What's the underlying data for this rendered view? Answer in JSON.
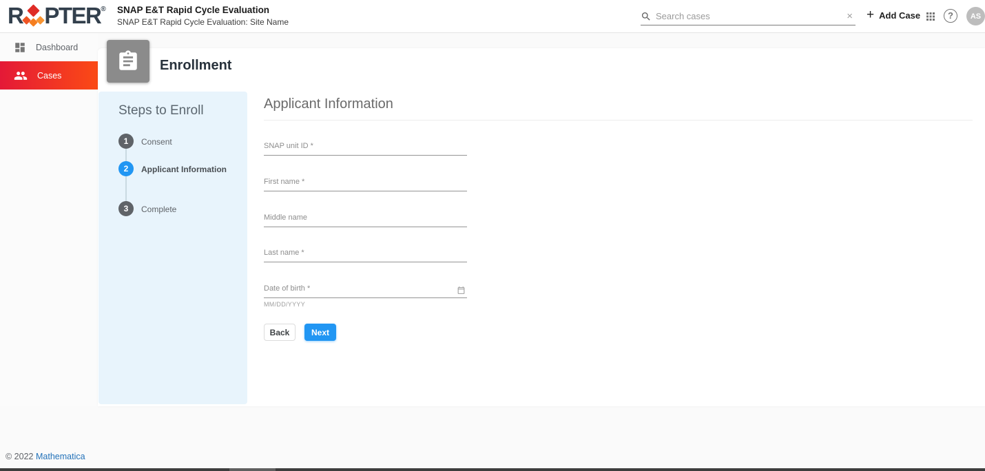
{
  "header": {
    "logo": {
      "text_prefix": "R",
      "text_suffix": "PTER",
      "registered": "®"
    },
    "title": "SNAP E&T Rapid Cycle Evaluation",
    "subtitle": "SNAP E&T Rapid Cycle Evaluation: Site Name",
    "search": {
      "placeholder": "Search cases",
      "clear_icon": "×"
    },
    "add_case": {
      "plus": "+",
      "label": "Add Case"
    },
    "help_glyph": "?",
    "avatar_initials": "AS"
  },
  "sidebar": {
    "items": [
      {
        "label": "Dashboard",
        "active": false
      },
      {
        "label": "Cases",
        "active": true
      }
    ]
  },
  "main": {
    "page_title": "Enrollment",
    "steps_panel": {
      "title": "Steps to Enroll",
      "steps": [
        {
          "number": "1",
          "label": "Consent",
          "state": "default"
        },
        {
          "number": "2",
          "label": "Applicant Information",
          "state": "active"
        },
        {
          "number": "3",
          "label": "Complete",
          "state": "default"
        }
      ]
    },
    "form": {
      "title": "Applicant Information",
      "fields": [
        {
          "label": "SNAP unit ID *",
          "value": ""
        },
        {
          "label": "First name *",
          "value": ""
        },
        {
          "label": "Middle name",
          "value": ""
        },
        {
          "label": "Last name *",
          "value": ""
        },
        {
          "label": "Date of birth *",
          "value": "",
          "helper": "MM/DD/YYYY"
        }
      ],
      "back_label": "Back",
      "next_label": "Next"
    }
  },
  "footer": {
    "copyright": "© 2022",
    "link_label": "Mathematica"
  },
  "colors": {
    "accent_blue": "#2196f3",
    "active_gradient_start": "#e41937",
    "active_gradient_end": "#fb4a15",
    "logo_navy": "#33404d",
    "steps_panel_bg": "#e8f4fc"
  }
}
